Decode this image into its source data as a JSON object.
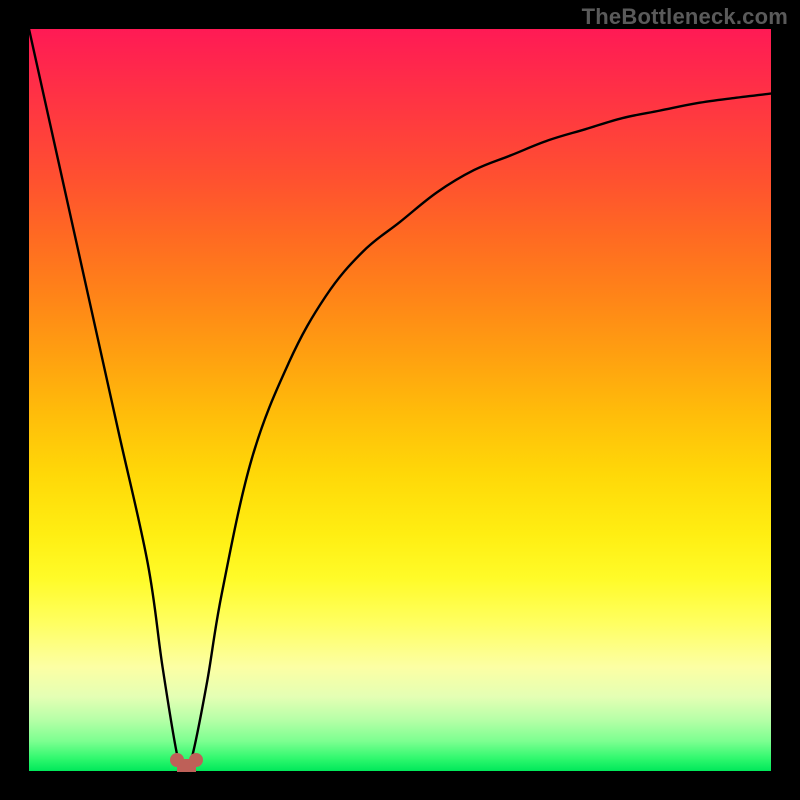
{
  "watermark": "TheBottleneck.com",
  "chart_data": {
    "type": "line",
    "title": "",
    "xlabel": "",
    "ylabel": "",
    "xlim": [
      0,
      100
    ],
    "ylim": [
      0,
      100
    ],
    "series": [
      {
        "name": "bottleneck-curve",
        "x": [
          0,
          4,
          8,
          12,
          16,
          18,
          20,
          21,
          22,
          24,
          26,
          30,
          35,
          40,
          45,
          50,
          55,
          60,
          65,
          70,
          75,
          80,
          85,
          90,
          95,
          100
        ],
        "y": [
          100,
          82,
          64,
          46,
          28,
          14,
          2,
          0,
          2,
          12,
          24,
          42,
          55,
          64,
          70,
          74,
          78,
          81,
          83,
          85,
          86.5,
          88,
          89,
          90,
          90.7,
          91.3
        ]
      }
    ],
    "markers": [
      {
        "x": 20,
        "y": 1.5,
        "color": "#be6058"
      },
      {
        "x": 22.5,
        "y": 1.5,
        "color": "#be6058"
      }
    ],
    "gradient_meaning": "vertical gradient from red (top, high bottleneck) through orange/yellow to green (bottom, zero bottleneck)"
  },
  "colors": {
    "frame": "#000000",
    "curve": "#000000",
    "marker": "#be6058",
    "watermark": "#5a5a5a"
  }
}
